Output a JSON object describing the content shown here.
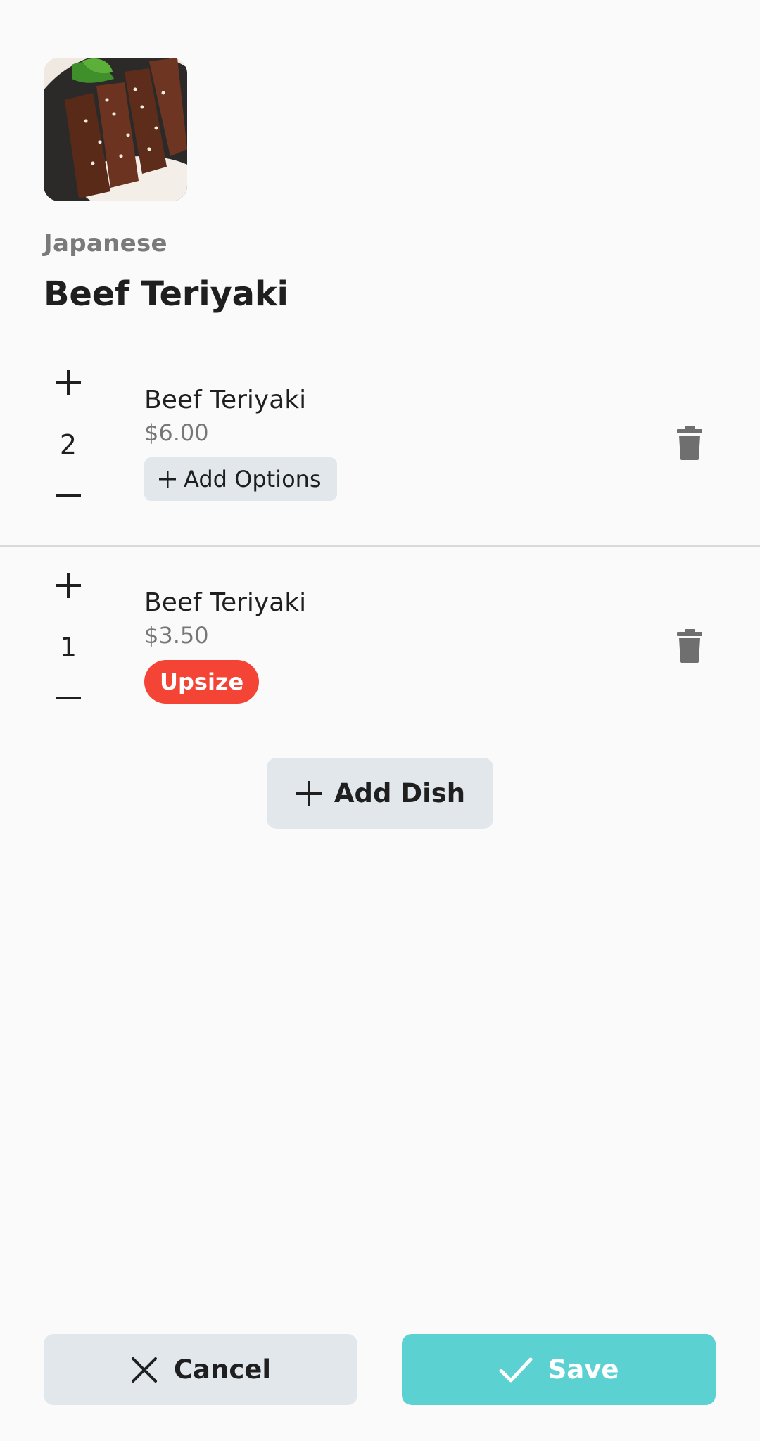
{
  "dish": {
    "image_icon": "dish-photo",
    "cuisine": "Japanese",
    "title": "Beef Teriyaki"
  },
  "cart_items": [
    {
      "name": "Beef Teriyaki",
      "price": "$6.00",
      "quantity": "2",
      "options_button_label": "Add Options"
    },
    {
      "name": "Beef Teriyaki",
      "price": "$3.50",
      "quantity": "1",
      "option_tag": "Upsize"
    }
  ],
  "actions": {
    "add_dish_label": "Add Dish",
    "cancel_label": "Cancel",
    "save_label": "Save"
  },
  "colors": {
    "background": "#fafafa",
    "button_gray": "#e1e7ea",
    "save_teal": "#5bd1d1",
    "tag_red": "#f44436",
    "muted_text": "#777777"
  }
}
